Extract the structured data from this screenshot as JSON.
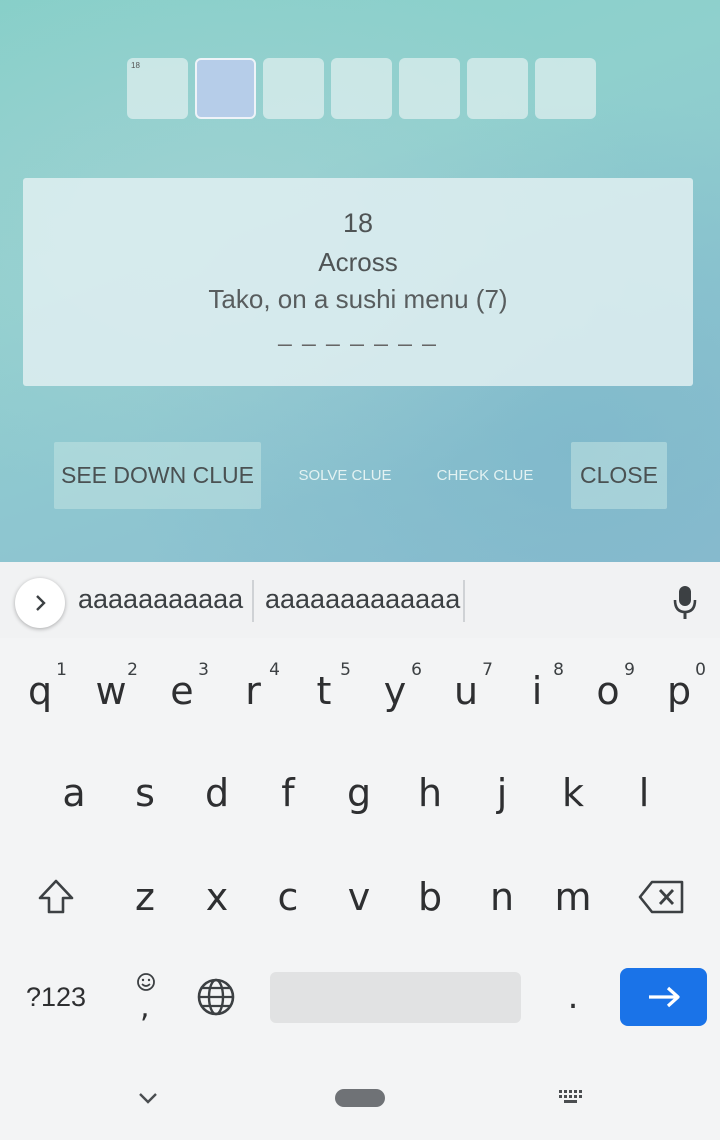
{
  "puzzle": {
    "cells": [
      {
        "number": "18",
        "active": false
      },
      {
        "number": "",
        "active": true
      },
      {
        "number": "",
        "active": false
      },
      {
        "number": "",
        "active": false
      },
      {
        "number": "",
        "active": false
      },
      {
        "number": "",
        "active": false
      },
      {
        "number": "",
        "active": false
      }
    ],
    "clue": {
      "number": "18",
      "direction": "Across",
      "text": "Tako, on a sushi menu (7)",
      "blanks": "_ _ _ _ _ _ _"
    },
    "buttons": {
      "see_down": "SEE DOWN CLUE",
      "solve": "SOLVE CLUE",
      "check": "CHECK CLUE",
      "close": "CLOSE"
    }
  },
  "keyboard": {
    "suggestions": [
      "aaaaaaaaaaa",
      "aaaaaaaaaaaaa"
    ],
    "row1": [
      {
        "k": "q",
        "h": "1"
      },
      {
        "k": "w",
        "h": "2"
      },
      {
        "k": "e",
        "h": "3"
      },
      {
        "k": "r",
        "h": "4"
      },
      {
        "k": "t",
        "h": "5"
      },
      {
        "k": "y",
        "h": "6"
      },
      {
        "k": "u",
        "h": "7"
      },
      {
        "k": "i",
        "h": "8"
      },
      {
        "k": "o",
        "h": "9"
      },
      {
        "k": "p",
        "h": "0"
      }
    ],
    "row2": [
      "a",
      "s",
      "d",
      "f",
      "g",
      "h",
      "j",
      "k",
      "l"
    ],
    "row3": [
      "z",
      "x",
      "c",
      "v",
      "b",
      "n",
      "m"
    ],
    "symbols_label": "?123",
    "comma_label": ",",
    "period_label": ".",
    "accent_color": "#1a73e8"
  }
}
